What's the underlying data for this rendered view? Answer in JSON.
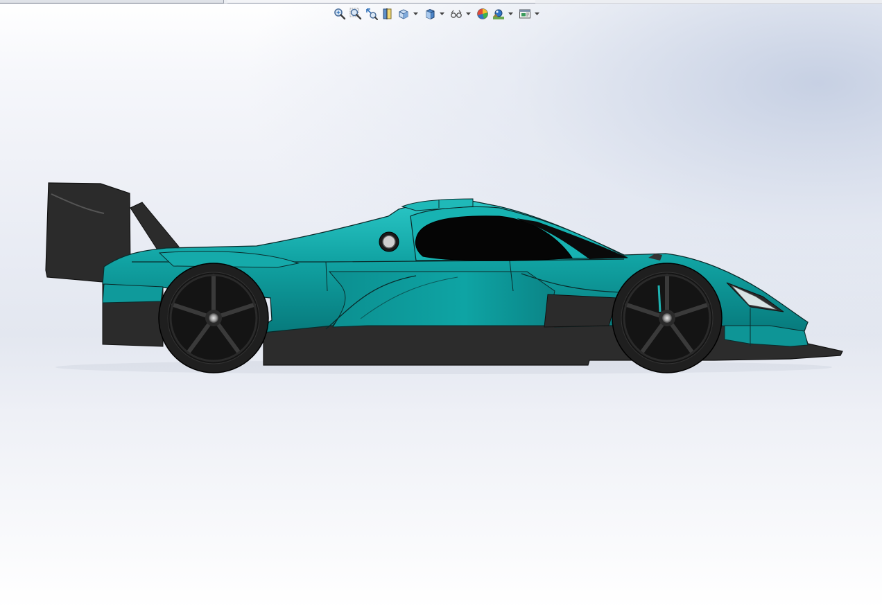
{
  "colors": {
    "background_top": "#ffffff",
    "background_mid": "#e3e7f0",
    "body_teal": "#0f9a9b",
    "body_teal_light": "#26c2c1",
    "body_teal_dark": "#0a7678",
    "carbon_black": "#2b2b2b",
    "glass": "#050505",
    "toolbar_accent": "#2d6fb8"
  },
  "heads_up_toolbar": {
    "items": [
      {
        "icon": "zoom-to-fit-icon",
        "has_dropdown": false
      },
      {
        "icon": "zoom-to-area-icon",
        "has_dropdown": false
      },
      {
        "icon": "previous-view-icon",
        "has_dropdown": false
      },
      {
        "icon": "section-view-icon",
        "has_dropdown": false
      },
      {
        "icon": "view-orientation-icon",
        "has_dropdown": true
      },
      {
        "icon": "display-style-icon",
        "has_dropdown": true
      },
      {
        "icon": "hide-show-items-icon",
        "has_dropdown": true
      },
      {
        "icon": "edit-appearance-icon",
        "has_dropdown": false
      },
      {
        "icon": "apply-scene-icon",
        "has_dropdown": true
      },
      {
        "icon": "view-settings-icon",
        "has_dropdown": true
      }
    ]
  },
  "model": {
    "icon": "race-car-model",
    "view": "side"
  }
}
